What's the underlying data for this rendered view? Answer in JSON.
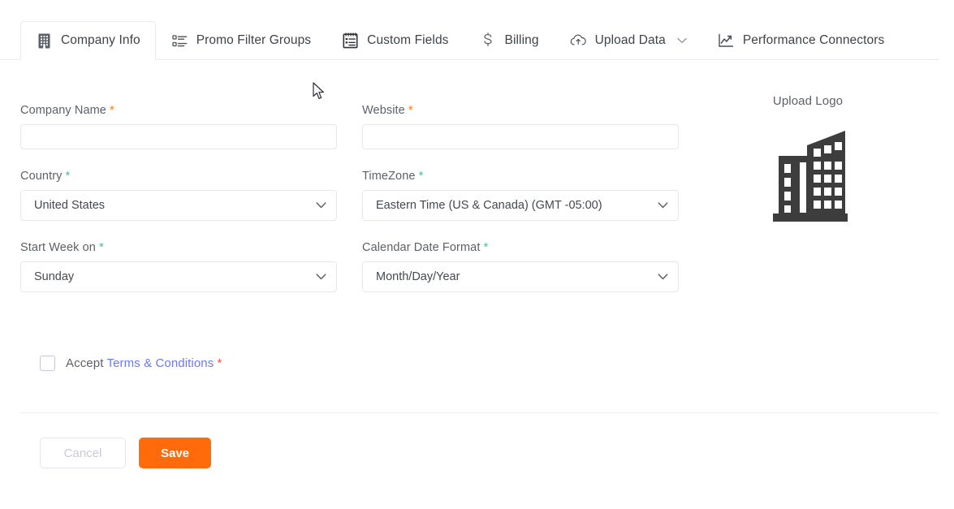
{
  "tabs": [
    {
      "label": "Company Info",
      "icon": "building-icon",
      "active": true,
      "caret": false
    },
    {
      "label": "Promo Filter Groups",
      "icon": "list-icon",
      "active": false,
      "caret": false
    },
    {
      "label": "Custom Fields",
      "icon": "clipboard-icon",
      "active": false,
      "caret": false
    },
    {
      "label": "Billing",
      "icon": "dollar-icon",
      "active": false,
      "caret": false
    },
    {
      "label": "Upload Data",
      "icon": "cloud-upload-icon",
      "active": false,
      "caret": true
    },
    {
      "label": "Performance Connectors",
      "icon": "line-chart-icon",
      "active": false,
      "caret": false
    }
  ],
  "form": {
    "company_name": {
      "label": "Company Name",
      "required_mark": "*",
      "required_color": "orange",
      "value": "",
      "placeholder": ""
    },
    "website": {
      "label": "Website",
      "required_mark": "*",
      "required_color": "orange",
      "value": "",
      "placeholder": ""
    },
    "country": {
      "label": "Country",
      "required_mark": "*",
      "required_color": "green",
      "value": "United States",
      "options": [
        "United States"
      ]
    },
    "timezone": {
      "label": "TimeZone",
      "required_mark": "*",
      "required_color": "green",
      "value": "Eastern Time (US & Canada) (GMT -05:00)",
      "options": [
        "Eastern Time (US & Canada) (GMT -05:00)"
      ]
    },
    "start_week_on": {
      "label": "Start Week on",
      "required_mark": "*",
      "required_color": "green",
      "value": "Sunday",
      "options": [
        "Sunday"
      ]
    },
    "calendar_date_format": {
      "label": "Calendar Date Format",
      "required_mark": "*",
      "required_color": "green",
      "value": "Month/Day/Year",
      "options": [
        "Month/Day/Year"
      ]
    }
  },
  "terms": {
    "prefix": "Accept",
    "link": "Terms & Conditions",
    "required_mark": "*",
    "checked": false
  },
  "footer": {
    "cancel_label": "Cancel",
    "save_label": "Save"
  },
  "logo": {
    "title": "Upload Logo",
    "icon": "office-building-illustration"
  },
  "colors": {
    "accent_orange": "#ff6b0b",
    "required_orange": "#ff7a18",
    "required_green": "#2ecc9b",
    "required_red": "#f0524d",
    "link_blue": "#6979f8",
    "border_gray": "#e6e7ea",
    "text_gray": "#5c6167",
    "logo_dark": "#3d3d3d"
  }
}
